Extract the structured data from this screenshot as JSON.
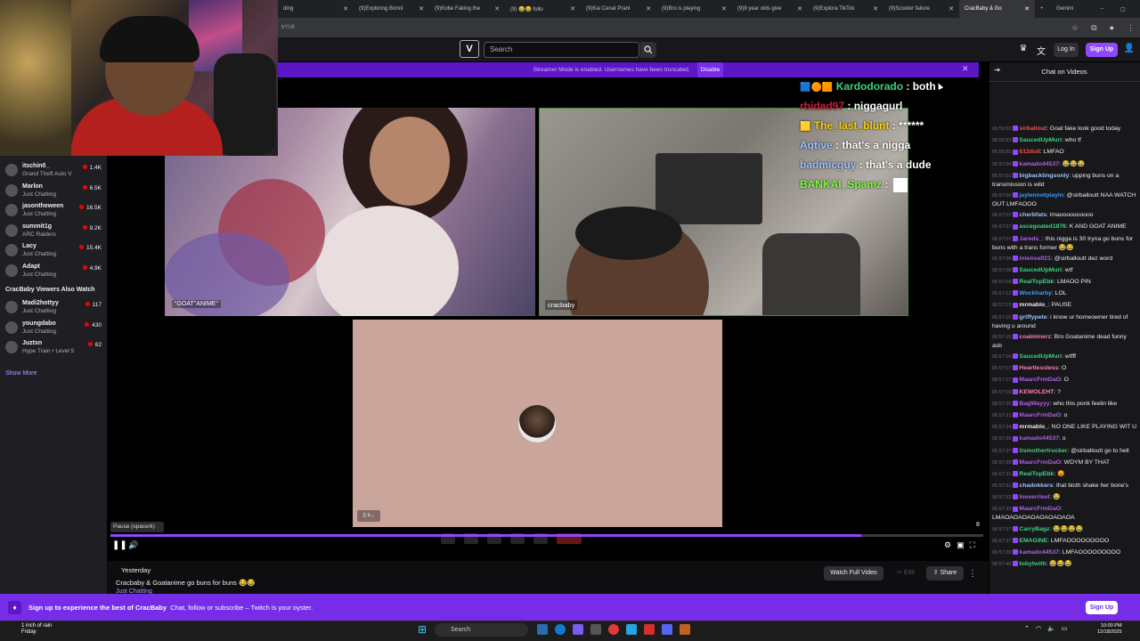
{
  "browser": {
    "tabs": [
      {
        "label": "ding"
      },
      {
        "label": "(9)Exploring Bonni"
      },
      {
        "label": "(9)Kobe Faking the"
      },
      {
        "label": "(9) 😂😂 follo"
      },
      {
        "label": "(9)Kai Cenat Pranl"
      },
      {
        "label": "(9)Bro is playing"
      },
      {
        "label": "(9)8 year olds give"
      },
      {
        "label": "(9)Explora TikTok"
      },
      {
        "label": "(9)Scooter failure"
      },
      {
        "label": "CracBaby & Go"
      }
    ],
    "gemini_label": "Gemini",
    "url_fragment": "bYU6"
  },
  "nav": {
    "search_placeholder": "Search",
    "login": "Log In",
    "signup": "Sign Up"
  },
  "sidebar": {
    "channels": [
      {
        "name": "itschin0_",
        "game": "Grand Theft Auto V",
        "viewers": "1.4K"
      },
      {
        "name": "Marlon",
        "game": "Just Chatting",
        "viewers": "6.5K"
      },
      {
        "name": "jasontheween",
        "game": "Just Chatting",
        "viewers": "16.5K"
      },
      {
        "name": "summit1g",
        "game": "ARC Raiders",
        "viewers": "9.2K"
      },
      {
        "name": "Lacy",
        "game": "Just Chatting",
        "viewers": "15.4K"
      },
      {
        "name": "Adapt",
        "game": "Just Chatting",
        "viewers": "4.9K"
      }
    ],
    "also_watch_title": "CracBaby Viewers Also Watch",
    "also_watch": [
      {
        "name": "Madi2hottyy",
        "game": "Just Chatting",
        "viewers": "117"
      },
      {
        "name": "youngdabo",
        "game": "Just Chatting",
        "viewers": "430"
      },
      {
        "name": "Juztxn",
        "game": "Hype Train • Level 5",
        "viewers": "62"
      }
    ],
    "show_more": "Show More"
  },
  "player": {
    "streamer_mode": "Streamer Mode is enabled. Usernames have been truncated.",
    "disable": "Disable",
    "tile1_label": "\"GOAT\"ANIME\"",
    "tile2_label": "cracbaby",
    "tile3_badge": "▯ s...",
    "tooltip": "Pause (space/k)",
    "seek_number": "8",
    "progress_fraction": 0.86,
    "overlay_chat": [
      {
        "user": "Kardodorado",
        "color": "#3cd27e",
        "text": ": both",
        "icons": "🟦🟠🟧"
      },
      {
        "user": "rbidad97",
        "color": "#c41e3a",
        "text": ": niggagurl",
        "icons": ""
      },
      {
        "user": "The_last_blunt",
        "color": "#f5d10c",
        "text": ": ******",
        "icons": "🟨"
      },
      {
        "user": "Aqtive",
        "color": "#9ec3ff",
        "text": ": that's a nigga",
        "icons": ""
      },
      {
        "user": "badmicguy",
        "color": "#9ec3ff",
        "text": ": that's a dude",
        "icons": ""
      },
      {
        "user": "BANKAI_Spamz",
        "color": "#7cff3c",
        "text": ":",
        "icons": ""
      }
    ]
  },
  "info": {
    "date": "Yesterday",
    "title": "Cracbaby & Goatanime go buns for buns 😂😂",
    "category": "Just Chatting",
    "watch_full": "Watch Full Video",
    "edit": "Edit",
    "share": "Share"
  },
  "chat": {
    "header": "Chat on Videos",
    "messages": [
      {
        "ts": "06:56:53",
        "user": "sirballout",
        "color": "#ff4a4a",
        "text": ": Goat fake look good today"
      },
      {
        "ts": "06:56:53",
        "user": "SaucedUpMuri",
        "color": "#3cd27e",
        "text": ": who tf"
      },
      {
        "ts": "06:56:55",
        "user": "612dull",
        "color": "#ff4a4a",
        "text": ": LMFAO"
      },
      {
        "ts": "06:57:00",
        "user": "kamado44537",
        "color": "#b05ee8",
        "text": ": 😂😂😂"
      },
      {
        "ts": "06:57:01",
        "user": "bigbacktingsonly",
        "color": "#9ec3ff",
        "text": ": upping buns on a transmission is wild"
      },
      {
        "ts": "06:57:06",
        "user": "jaylennotplayin",
        "color": "#3c9bff",
        "text": ": @sirballoutt NAA WATCH OUT LMFAOOO"
      },
      {
        "ts": "06:57:07",
        "user": "cherbfats",
        "color": "#9ec3ff",
        "text": ": lmaoooooooooo"
      },
      {
        "ts": "06:57:07",
        "user": "ascegoated1876",
        "color": "#3cd27e",
        "text": ": K AND GOAT ANIME"
      },
      {
        "ts": "06:57:07",
        "user": "Jareds_",
        "color": "#b05ee8",
        "text": ": this nigga is 30 tryna go buns for buns with a trans former 😂😂"
      },
      {
        "ts": "06:57:08",
        "user": "intenself21",
        "color": "#b05ee8",
        "text": ": @sirballoutt dez word"
      },
      {
        "ts": "06:57:08",
        "user": "SaucedUpMuri",
        "color": "#3cd27e",
        "text": ": wtf"
      },
      {
        "ts": "06:57:09",
        "user": "RealTopEbk",
        "color": "#3cd27e",
        "text": ": LMAOO PIN"
      },
      {
        "ts": "06:57:12",
        "user": "Wockharby",
        "color": "#3c9bff",
        "text": ": LOL"
      },
      {
        "ts": "06:57:13",
        "user": "mrmablo_",
        "color": "#efeff1",
        "text": ": PAUSE"
      },
      {
        "ts": "06:57:15",
        "user": "griffypete",
        "color": "#9ec3ff",
        "text": ": i know ur homeowner tired of having u around"
      },
      {
        "ts": "06:57:15",
        "user": "coalminerz",
        "color": "#ff7fb0",
        "text": ": Bro Goatanime dead funny asb"
      },
      {
        "ts": "06:57:16",
        "user": "SaucedUpMuri",
        "color": "#3cd27e",
        "text": ": wtfff"
      },
      {
        "ts": "06:57:17",
        "user": "Heartlessless",
        "color": "#ff7fb0",
        "text": ": O"
      },
      {
        "ts": "06:57:17",
        "user": "MaarcFrmDaO",
        "color": "#b05ee8",
        "text": ": O"
      },
      {
        "ts": "06:57:19",
        "user": "KEWOLEHT",
        "color": "#ff7fb0",
        "text": ": ?"
      },
      {
        "ts": "06:57:20",
        "user": "BagWayyy",
        "color": "#b05ee8",
        "text": ": who this ponk feelin like"
      },
      {
        "ts": "06:57:21",
        "user": "MaarcFrmDaO",
        "color": "#b05ee8",
        "text": ": o"
      },
      {
        "ts": "06:57:24",
        "user": "mrmablo_",
        "color": "#efeff1",
        "text": ": NO ONE LIKE PLAYING WIT U"
      },
      {
        "ts": "06:57:26",
        "user": "kamado44537",
        "color": "#b05ee8",
        "text": ": o"
      },
      {
        "ts": "06:57:27",
        "user": "itsmothertrucker",
        "color": "#3cd27e",
        "text": ": @sirballoutt go to hell"
      },
      {
        "ts": "06:57:29",
        "user": "MaarcFrmDaO",
        "color": "#b05ee8",
        "text": ": WDYM BY THAT"
      },
      {
        "ts": "06:57:31",
        "user": "RealTopEbk",
        "color": "#3cd27e",
        "text": ": 😡"
      },
      {
        "ts": "06:57:31",
        "user": "chadokkers",
        "color": "#9ec3ff",
        "text": ": that bicth shake her bone's"
      },
      {
        "ts": "06:57:32",
        "user": "Ineverrleel",
        "color": "#b05ee8",
        "text": ": 😂"
      },
      {
        "ts": "06:57:33",
        "user": "MaarcFrmDaO",
        "color": "#b05ee8",
        "text": ": LMAOAOAOAOAOAOAOAOA"
      },
      {
        "ts": "06:57:37",
        "user": "CarryBagz",
        "color": "#3cd27e",
        "text": ": 😂😂😂😂"
      },
      {
        "ts": "06:57:37",
        "user": "EMAGINE",
        "color": "#3cd27e",
        "text": ": LMFAOOOOOOOOO"
      },
      {
        "ts": "06:57:39",
        "user": "kamado44537",
        "color": "#b05ee8",
        "text": ": LMFAOOOOOOOOO"
      },
      {
        "ts": "06:57:40",
        "user": "tobytwith",
        "color": "#3cd27e",
        "text": ": 😂😂😂"
      }
    ]
  },
  "banner": {
    "text": "Sign up to experience the best of CracBaby",
    "subtext": "Chat, follow or subscribe – Twitch is your oyster.",
    "signup": "Sign Up"
  },
  "taskbar": {
    "weather_line1": "1 inch of rain",
    "weather_line2": "Friday",
    "search": "Search",
    "time": "10:00 PM",
    "date": "12/18/2025"
  }
}
